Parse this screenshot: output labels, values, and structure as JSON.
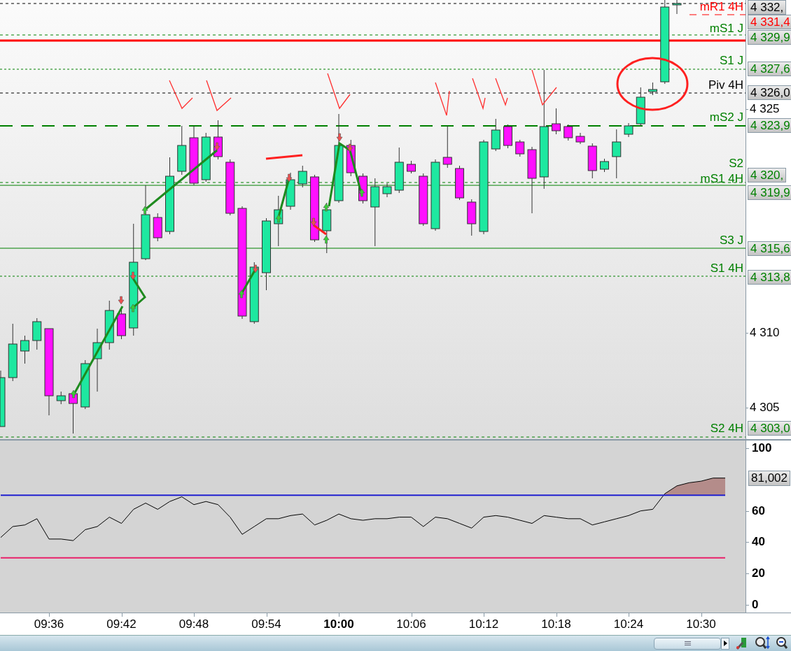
{
  "price_chart": {
    "levels": [
      {
        "tag": "4 332,",
        "color": "#000000",
        "kind": "dashed"
      },
      {
        "label": "mR1 4H",
        "tag": "4 331,4",
        "color": "#ff0000",
        "kind": "short"
      },
      {
        "label": "mS1 J",
        "tag": "4 329,9",
        "color": "#008000",
        "kind": "dashed"
      },
      {
        "color": "#ff0000",
        "kind": "thick"
      },
      {
        "label": "S1 J",
        "tag": "4 327,6",
        "color": "#008000",
        "kind": "fine"
      },
      {
        "label": "Piv 4H",
        "tag": "4 326,0",
        "color": "#000000",
        "kind": "dashed"
      },
      {
        "label": "mS2 J",
        "tag": "4 323,9",
        "color": "#008000",
        "kind": "long"
      },
      {
        "label": "S2",
        "tag": "4 320,",
        "color": "#008000",
        "kind": "dashed"
      },
      {
        "label": "mS1 4H",
        "tag": "4 319,9",
        "color": "#008000",
        "kind": "solid"
      },
      {
        "label": "S3 J",
        "tag": "4 315,6",
        "color": "#008000",
        "kind": "solid"
      },
      {
        "label": "S1 4H",
        "tag": "4 313,8",
        "color": "#008000",
        "kind": "fine"
      },
      {
        "label": "S2 4H",
        "tag": "4 303,0",
        "color": "#008000",
        "kind": "dashed"
      }
    ],
    "axis_ticks": [
      "4 325",
      "4 310",
      "4 305"
    ]
  },
  "oscillator": {
    "chart_data": {
      "type": "line",
      "ylim": [
        -5,
        105
      ],
      "yticks": [
        0,
        20,
        40,
        60,
        100
      ],
      "series": [
        {
          "color": "#000000",
          "values": [
            43,
            50,
            51,
            55,
            42,
            42,
            41,
            48,
            50,
            56,
            52,
            61,
            65,
            61,
            66,
            69,
            64,
            66,
            64,
            56,
            45,
            50,
            55,
            55,
            57,
            58,
            51,
            54,
            58,
            55,
            54,
            55,
            55,
            56,
            56,
            50,
            56,
            55,
            52,
            49,
            56,
            57,
            56,
            54,
            52,
            57,
            56,
            55,
            55,
            51,
            53,
            55,
            57,
            60,
            61,
            71,
            76,
            78,
            79,
            81,
            81
          ]
        },
        {
          "color": "#2020d0",
          "values": [
            70,
            70,
            70,
            70,
            70,
            70,
            70,
            70,
            70,
            70,
            70,
            70,
            70,
            70,
            70,
            70,
            70,
            70,
            70,
            70,
            70,
            70,
            70,
            70,
            70,
            70,
            70,
            70,
            70,
            70,
            70,
            70,
            70,
            70,
            70,
            70,
            70,
            70,
            70,
            70,
            70,
            70,
            70,
            70,
            70,
            70,
            70,
            70,
            70,
            70,
            70,
            70,
            70,
            70,
            70,
            70,
            70,
            70,
            70,
            70,
            70
          ]
        },
        {
          "color": "#e8206a",
          "values": [
            30,
            30,
            30,
            30,
            30,
            30,
            30,
            30,
            30,
            30,
            30,
            30,
            30,
            30,
            30,
            30,
            30,
            30,
            30,
            30,
            30,
            30,
            30,
            30,
            30,
            30,
            30,
            30,
            30,
            30,
            30,
            30,
            30,
            30,
            30,
            30,
            30,
            30,
            30,
            30,
            30,
            30,
            30,
            30,
            30,
            30,
            30,
            30,
            30,
            30,
            30,
            30,
            30,
            30,
            30,
            30,
            30,
            30,
            30,
            30,
            30
          ]
        }
      ]
    },
    "value_tag": "81,002"
  },
  "time_axis": [
    {
      "label": "09:36",
      "emphasized": false
    },
    {
      "label": "09:42",
      "emphasized": false
    },
    {
      "label": "09:48",
      "emphasized": false
    },
    {
      "label": "09:54",
      "emphasized": false
    },
    {
      "label": "10:00",
      "emphasized": true
    },
    {
      "label": "10:06",
      "emphasized": false
    },
    {
      "label": "10:12",
      "emphasized": false
    },
    {
      "label": "10:18",
      "emphasized": false
    },
    {
      "label": "10:24",
      "emphasized": false
    },
    {
      "label": "10:30",
      "emphasized": false
    }
  ]
}
